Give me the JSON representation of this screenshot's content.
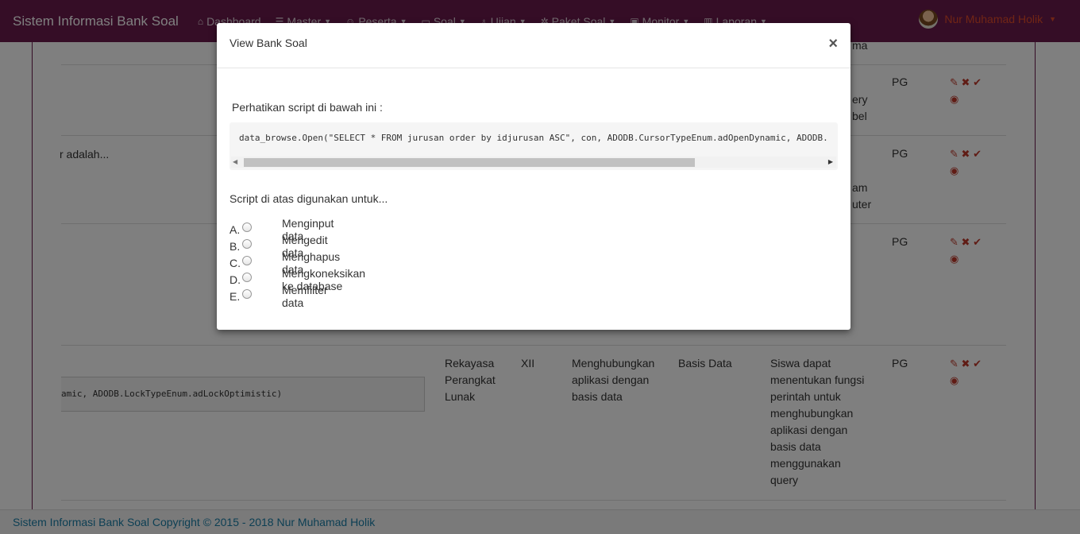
{
  "navbar": {
    "brand": "Sistem Informasi Bank Soal",
    "items": [
      {
        "label": "Dashboard",
        "icon": "home-icon",
        "glyph": "⌂",
        "dropdown": false
      },
      {
        "label": "Master",
        "icon": "database-icon",
        "glyph": "☰",
        "dropdown": true
      },
      {
        "label": "Peserta",
        "icon": "users-icon",
        "glyph": "☺",
        "dropdown": true
      },
      {
        "label": "Soal",
        "icon": "monitor-icon",
        "glyph": "▭",
        "dropdown": true
      },
      {
        "label": "Ujian",
        "icon": "lightbulb-icon",
        "glyph": "♁",
        "dropdown": true
      },
      {
        "label": "Paket Soal",
        "icon": "gear-icon",
        "glyph": "✲",
        "dropdown": true
      },
      {
        "label": "Monitor",
        "icon": "calendar-icon",
        "glyph": "▣",
        "dropdown": true
      },
      {
        "label": "Laporan",
        "icon": "bar-chart-icon",
        "glyph": "▥",
        "dropdown": true
      }
    ],
    "user": "Nur Muhamad Holik"
  },
  "background": {
    "row1": {
      "partial_text_top": "ma",
      "partial_text_a": "ery",
      "partial_text_b": "bel",
      "type": "PG"
    },
    "row2": {
      "partial_text": "r adalah...",
      "partial_right_a": "am",
      "partial_right_b": "uter",
      "type": "PG"
    },
    "row3": {
      "type": "PG"
    },
    "row4": {
      "code": "amic, ADODB.LockTypeEnum.adLockOptimistic)",
      "jurusan": [
        "Rekayasa",
        "Perangkat",
        "Lunak"
      ],
      "kelas": "XII",
      "kd": [
        "Menghubungkan",
        "aplikasi dengan",
        "basis data"
      ],
      "mapel": "Basis Data",
      "indikator": [
        "Siswa dapat",
        "menentukan fungsi",
        "perintah untuk",
        "menghubungkan",
        "aplikasi dengan",
        "basis data",
        "menggunakan",
        "query"
      ],
      "type": "PG"
    }
  },
  "footer": {
    "text": "Sistem Informasi Bank Soal Copyright © 2015 - 2018 Nur Muhamad Holik"
  },
  "modal": {
    "title": "View Bank Soal",
    "close": "×",
    "intro": "Perhatikan script di bawah ini :",
    "code": "data_browse.Open(\"SELECT * FROM jurusan order by idjurusan ASC\", con, ADODB.CursorTypeEnum.adOpenDynamic, ADODB.",
    "question": "Script di atas digunakan untuk...",
    "options": [
      {
        "letter": "A.",
        "label": "Menginput data"
      },
      {
        "letter": "B.",
        "label": "Mengedit data"
      },
      {
        "letter": "C.",
        "label": "Menghapus data"
      },
      {
        "letter": "D.",
        "label": "Mengkoneksikan ke database"
      },
      {
        "letter": "E.",
        "label": "Memfilter data"
      }
    ]
  },
  "colors": {
    "navbar": "#6a1b4d",
    "accent": "#c0392b",
    "footer_text": "#1a7fa8"
  }
}
